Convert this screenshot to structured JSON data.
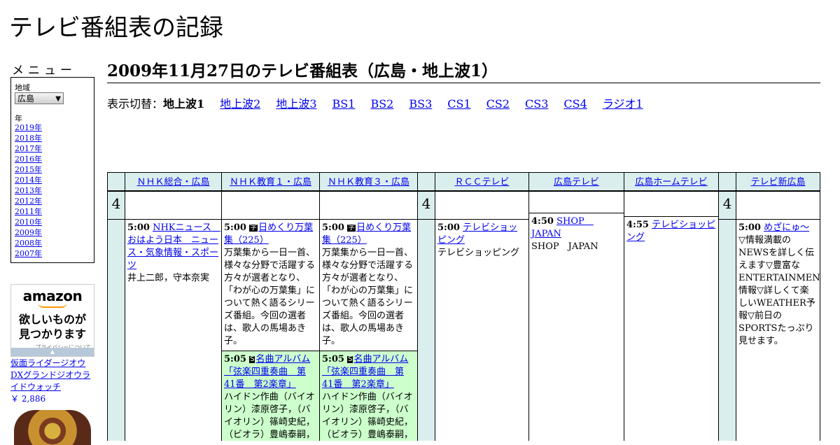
{
  "site": {
    "title": "テレビ番組表の記録"
  },
  "menu": {
    "title": "メニュー",
    "region_label": "地域",
    "region_value": "広島",
    "year_label": "年",
    "years": [
      "2019年",
      "2018年",
      "2017年",
      "2016年",
      "2015年",
      "2014年",
      "2013年",
      "2012年",
      "2011年",
      "2010年",
      "2009年",
      "2008年",
      "2007年"
    ]
  },
  "ad": {
    "logo": "amazon",
    "tagline_1": "欲しいものが",
    "tagline_2": "見つかります",
    "privacy": "プライバシーについて",
    "product_name": "仮面ライダージオウ DXグランドジオウライドウォッチ",
    "product_price": "￥ 2,886"
  },
  "page": {
    "heading": "2009年11月27日のテレビ番組表（広島・地上波1）"
  },
  "switcher": {
    "label": "表示切替：",
    "current": "地上波1",
    "links": [
      "地上波2",
      "地上波3",
      "BS1",
      "BS2",
      "BS3",
      "CS1",
      "CS2",
      "CS3",
      "CS4",
      "ラジオ1"
    ]
  },
  "grid": {
    "hour": "4",
    "channels": [
      "ＮＨＫ総合・広島",
      "ＮＨＫ教育１・広島",
      "ＮＨＫ教育３・広島",
      "ＲＣＣテレビ",
      "広島テレビ",
      "広島ホームテレビ",
      "テレビ新広島"
    ],
    "programs": {
      "nhk_g": {
        "time": "5:00",
        "title": "NHKニュース　おはよう日本　ニュース・気象情報・スポーツ",
        "desc": "井上二郎，守本奈実"
      },
      "etv1_a": {
        "time": "5:00",
        "badge": "字",
        "title": "日めくり万葉集（225）",
        "desc": "万葉集から一日一首、様々な分野で活躍する方々が選者となり、「わが心の万葉集」について熱く語るシリーズ番組。今回の選者は、歌人の馬場あき子。"
      },
      "etv1_b": {
        "time": "5:05",
        "badge": "S",
        "title": "名曲アルバム「弦楽四重奏曲　第41番　第2楽章」",
        "desc": "ハイドン作曲（バイオリン）漆原啓子，（バイオリン）篠崎史紀，（ビオラ）豊嶋泰嗣，"
      },
      "etv3_a": {
        "time": "5:00",
        "badge": "字",
        "title": "日めくり万葉集（225）",
        "desc": "万葉集から一日一首、様々な分野で活躍する方々が選者となり、「わが心の万葉集」について熱く語るシリーズ番組。今回の選者は、歌人の馬場あき子。"
      },
      "etv3_b": {
        "time": "5:05",
        "badge": "S",
        "title": "名曲アルバム「弦楽四重奏曲　第41番　第2楽章」",
        "desc": "ハイドン作曲（バイオリン）漆原啓子，（バイオリン）篠崎史紀，（ビオラ）豊嶋泰嗣，"
      },
      "rcc": {
        "time": "5:00",
        "title": "テレビショッピング",
        "desc": "テレビショッピング"
      },
      "htv": {
        "time": "4:50",
        "title": "SHOP　JAPAN",
        "desc": "SHOP　JAPAN"
      },
      "hometv": {
        "time": "4:55",
        "title": "テレビショッピング",
        "desc": ""
      },
      "tss": {
        "time": "5:00",
        "title": "めざにゅ～",
        "desc": "▽情報満載のNEWSを詳しく伝えます▽豊富なENTERTAINMENT情報▽詳しくて楽しいWEATHER予報▽前日のSPORTSたっぷり見せます。"
      }
    }
  }
}
